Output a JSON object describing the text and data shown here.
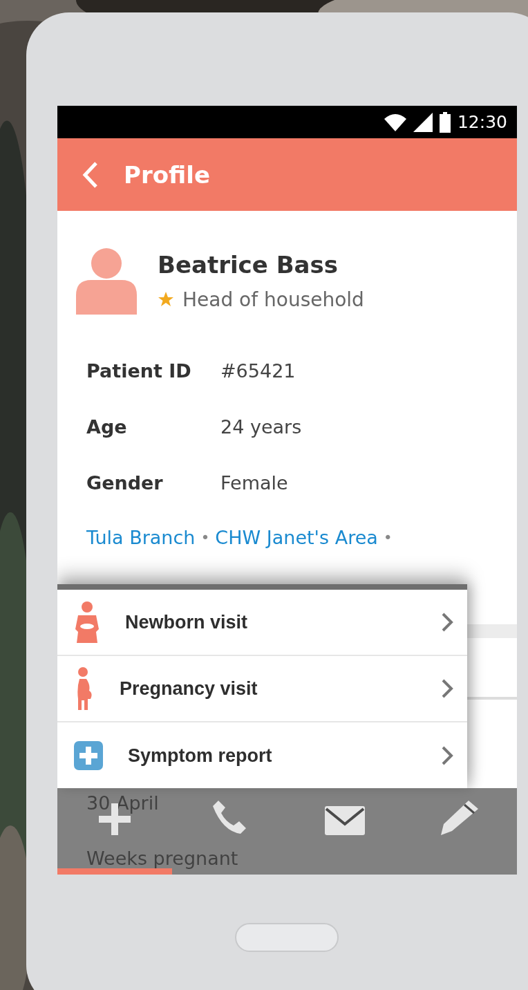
{
  "status_bar": {
    "time": "12:30"
  },
  "app_bar": {
    "title": "Profile"
  },
  "profile": {
    "name": "Beatrice Bass",
    "role": "Head of household",
    "starred": true
  },
  "details": [
    {
      "label": "Patient ID",
      "value": "#65421"
    },
    {
      "label": "Age",
      "value": "24 years"
    },
    {
      "label": "Gender",
      "value": "Female"
    }
  ],
  "location": {
    "links": [
      "Tula Branch",
      "CHW Janet's Area"
    ],
    "separator": "•"
  },
  "background_rows": [
    "30 April",
    "Weeks pregnant"
  ],
  "visit_menu": [
    {
      "kind": "newborn",
      "label": "Newborn visit"
    },
    {
      "kind": "pregnancy",
      "label": "Pregnancy visit"
    },
    {
      "kind": "symptom",
      "label": "Symptom report"
    }
  ],
  "actions": [
    {
      "kind": "add",
      "selected": true
    },
    {
      "kind": "call",
      "selected": false
    },
    {
      "kind": "message",
      "selected": false
    },
    {
      "kind": "edit",
      "selected": false
    }
  ]
}
